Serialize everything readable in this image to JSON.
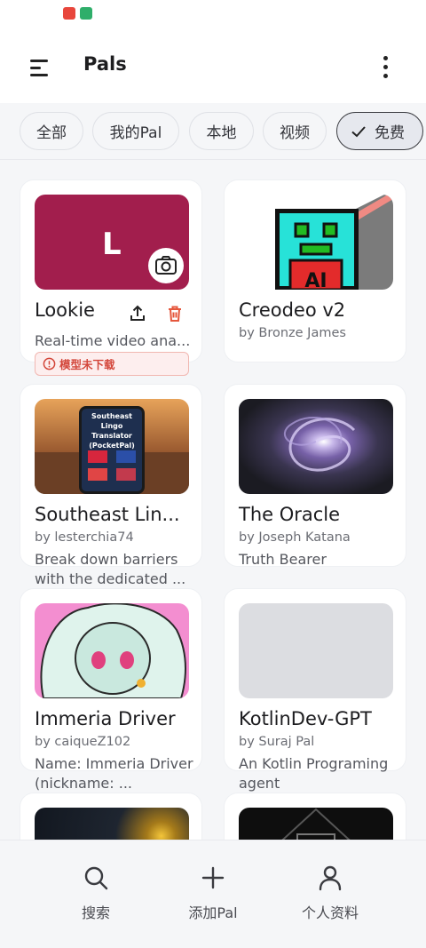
{
  "app": {
    "title": "Pals"
  },
  "filters": [
    {
      "label": "全部",
      "selected": false
    },
    {
      "label": "我的Pal",
      "selected": false
    },
    {
      "label": "本地",
      "selected": false
    },
    {
      "label": "视频",
      "selected": false
    },
    {
      "label": "免费",
      "selected": true
    }
  ],
  "cards": [
    {
      "name": "Lookie",
      "author": "",
      "description": "Real-time video ana...",
      "thumbnail_letter": "L",
      "badge": "模型未下载"
    },
    {
      "name": "Creodeo v2",
      "author": "by Bronze James",
      "description": ""
    },
    {
      "name": "Southeast Lin...",
      "author": "by lesterchia74",
      "description": "Break down barriers with the dedicated ...",
      "thumbnail_text": "Southeast Lingo Translator (PocketPal)"
    },
    {
      "name": "The Oracle",
      "author": "by Joseph Katana",
      "description": "Truth Bearer"
    },
    {
      "name": "Immeria Driver",
      "author": "by caiqueZ102",
      "description": "Name: Immeria Driver (nickname: ..."
    },
    {
      "name": "KotlinDev-GPT",
      "author": "by Suraj Pal",
      "description": "An Kotlin Programing agent"
    }
  ],
  "creodeo_thumb_text": "AI",
  "bottom_nav": [
    {
      "label": "搜索",
      "icon": "search-icon"
    },
    {
      "label": "添加Pal",
      "icon": "plus-icon"
    },
    {
      "label": "个人资料",
      "icon": "person-icon"
    }
  ],
  "colors": {
    "lookie_thumb": "#a21e4d",
    "badge_text": "#d3463a",
    "delete_icon": "#e5573c"
  }
}
